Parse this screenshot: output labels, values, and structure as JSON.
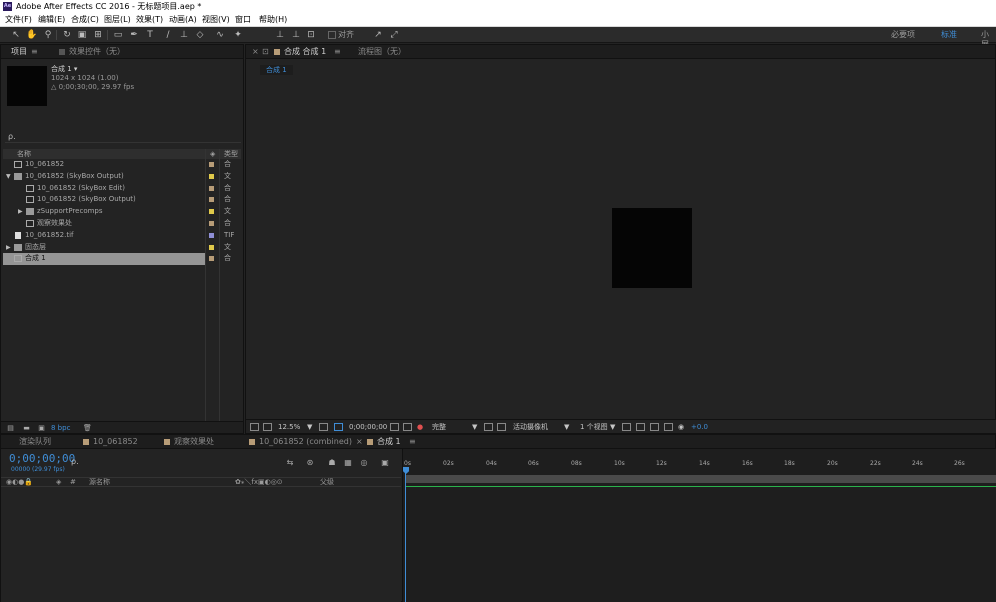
{
  "window": {
    "title": "Adobe After Effects CC 2016 - 无标题项目.aep *",
    "logo": "Ae"
  },
  "menu": [
    "文件(F)",
    "编辑(E)",
    "合成(C)",
    "图层(L)",
    "效果(T)",
    "动画(A)",
    "视图(V)",
    "窗口",
    "帮助(H)"
  ],
  "toolbar": {
    "align_label": "对齐",
    "workspaces": [
      "必要项",
      "标准",
      "小屏"
    ],
    "active_workspace": "标准"
  },
  "project_panel": {
    "tabs": [
      "项目",
      "效果控件（无）"
    ],
    "menu_icon": "≡",
    "comp_info": {
      "name": "合成 1 ▾",
      "size": "1024 x 1024 (1.00)",
      "duration": "△ 0;00;30;00, 29.97 fps"
    },
    "search_icon_text": "ρ.",
    "columns": {
      "name": "名称",
      "type": "类型"
    },
    "items": [
      {
        "name": "10_061852",
        "type": "合",
        "tag_color": "#b79c77"
      },
      {
        "name": "10_061852 (SkyBox Output)",
        "type": "文",
        "tag_color": "#e0c94a"
      },
      {
        "name": "10_061852 (SkyBox Edit)",
        "type": "合",
        "tag_color": "#b79c77"
      },
      {
        "name": "10_061852 (SkyBox Output)",
        "type": "合",
        "tag_color": "#b79c77"
      },
      {
        "name": "zSupportPrecomps",
        "type": "文",
        "tag_color": "#e0c94a"
      },
      {
        "name": "观察效果处",
        "type": "合",
        "tag_color": "#b79c77"
      },
      {
        "name": "10_061852.tif",
        "type": "TIF",
        "tag_color": "#8f8fd6"
      },
      {
        "name": "固态层",
        "type": "文",
        "tag_color": "#e0c94a"
      },
      {
        "name": "合成 1",
        "type": "合",
        "tag_color": "#b79c77"
      }
    ],
    "bpc": "8 bpc"
  },
  "viewer": {
    "tabs": [
      "合成 合成 1",
      "流程图（无）"
    ],
    "breadcrumb": "合成 1",
    "zoom": "12.5%",
    "timecode": "0;00;00;00",
    "resolution": "完整",
    "camera": "活动摄像机",
    "views": "1 个视图",
    "exposure": "+0.0"
  },
  "timeline": {
    "tabs": [
      "渲染队列",
      "10_061852",
      "观察效果处",
      "10_061852 (combined)",
      "合成 1"
    ],
    "timecode": "0;00;00;00",
    "fps": "00000 (29.97 fps)",
    "columns": {
      "source": "源名称",
      "parent": "父级"
    },
    "ruler": [
      "0s",
      "02s",
      "04s",
      "06s",
      "08s",
      "10s",
      "12s",
      "14s",
      "16s",
      "18s",
      "20s",
      "22s",
      "24s",
      "26s"
    ]
  },
  "colors": {
    "accent": "#3f8dd6",
    "panel_bg": "#232323",
    "selected_row": "#959595",
    "green": "#2bb24c"
  }
}
